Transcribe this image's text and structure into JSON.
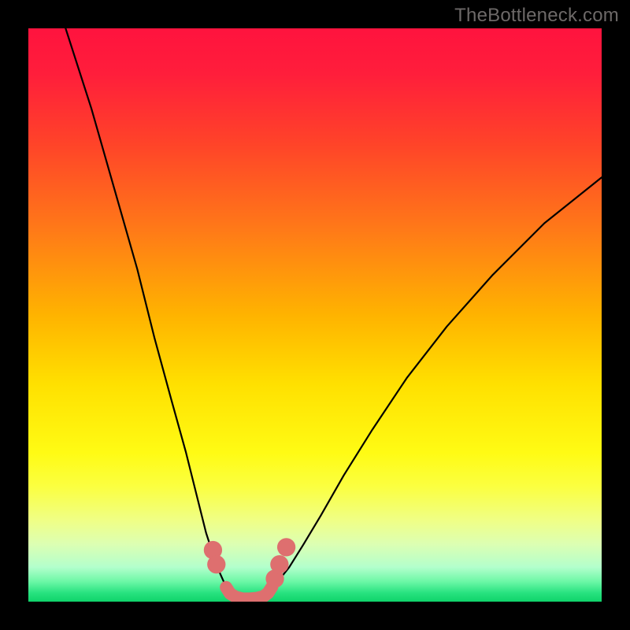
{
  "watermark": "TheBottleneck.com",
  "chart_data": {
    "type": "line",
    "title": "",
    "xlabel": "",
    "ylabel": "",
    "xlim": [
      0,
      100
    ],
    "ylim": [
      0,
      100
    ],
    "grid": false,
    "annotations": [],
    "gradient_stops": [
      {
        "offset": 0.0,
        "color": "#ff133e"
      },
      {
        "offset": 0.08,
        "color": "#ff1e3b"
      },
      {
        "offset": 0.2,
        "color": "#ff4329"
      },
      {
        "offset": 0.35,
        "color": "#ff7918"
      },
      {
        "offset": 0.5,
        "color": "#ffb300"
      },
      {
        "offset": 0.62,
        "color": "#ffe000"
      },
      {
        "offset": 0.74,
        "color": "#fffb14"
      },
      {
        "offset": 0.8,
        "color": "#fbff41"
      },
      {
        "offset": 0.86,
        "color": "#efff88"
      },
      {
        "offset": 0.9,
        "color": "#dcffb3"
      },
      {
        "offset": 0.94,
        "color": "#b3ffcc"
      },
      {
        "offset": 0.965,
        "color": "#6cf7a6"
      },
      {
        "offset": 0.985,
        "color": "#27e27f"
      },
      {
        "offset": 1.0,
        "color": "#0fd36a"
      }
    ],
    "series": [
      {
        "name": "left-branch",
        "stroke": "#000000",
        "x": [
          6.5,
          11,
          15,
          19,
          22,
          25,
          27.5,
          29.5,
          31,
          32.3,
          33.4,
          34.3,
          35
        ],
        "y": [
          100,
          86,
          72,
          58,
          46,
          35,
          26,
          18,
          12,
          8,
          5,
          3,
          2
        ]
      },
      {
        "name": "right-branch",
        "stroke": "#000000",
        "x": [
          42,
          43.5,
          45.5,
          48,
          51,
          55,
          60,
          66,
          73,
          81,
          90,
          100
        ],
        "y": [
          2,
          3.5,
          6,
          10,
          15,
          22,
          30,
          39,
          48,
          57,
          66,
          74
        ]
      },
      {
        "name": "valley-floor",
        "stroke": "#de6f6f",
        "x": [
          34.5,
          35.2,
          36.2,
          37.4,
          38.6,
          39.8,
          41,
          41.8,
          42.5
        ],
        "y": [
          2.5,
          1.4,
          0.8,
          0.5,
          0.5,
          0.6,
          0.9,
          1.5,
          2.6
        ]
      }
    ],
    "markers": [
      {
        "name": "left-marker-1",
        "x": 32.2,
        "y": 9.0,
        "r": 1.6,
        "color": "#de6f6f"
      },
      {
        "name": "left-marker-2",
        "x": 32.8,
        "y": 6.5,
        "r": 1.6,
        "color": "#de6f6f"
      },
      {
        "name": "right-marker-1",
        "x": 43.0,
        "y": 4.0,
        "r": 1.6,
        "color": "#de6f6f"
      },
      {
        "name": "right-marker-2",
        "x": 43.8,
        "y": 6.5,
        "r": 1.6,
        "color": "#de6f6f"
      },
      {
        "name": "right-marker-3",
        "x": 45.0,
        "y": 9.5,
        "r": 1.6,
        "color": "#de6f6f"
      }
    ]
  }
}
